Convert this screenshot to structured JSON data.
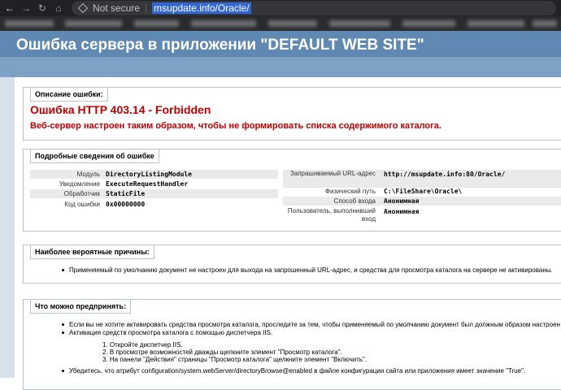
{
  "browser": {
    "security_label": "Not secure",
    "url": "msupdate.info/Oracle/"
  },
  "page": {
    "title": "Ошибка сервера в приложении \"DEFAULT WEB SITE\""
  },
  "error_section": {
    "header": "Описание ошибки:",
    "code": "Ошибка HTTP 403.14 - Forbidden",
    "message": "Веб-сервер настроен таким образом, чтобы не формировать списка содержимого каталога."
  },
  "details_section": {
    "header": "Подробные сведения об ошибке",
    "left": [
      {
        "label": "Модуль",
        "value": "DirectoryListingModule"
      },
      {
        "label": "Уведомление",
        "value": "ExecuteRequestHandler"
      },
      {
        "label": "Обработчик",
        "value": "StaticFile"
      },
      {
        "label": "Код ошибки",
        "value": "0x00000000"
      }
    ],
    "right": [
      {
        "label": "Запрашиваемый URL-адрес",
        "value": "http://msupdate.info:80/Oracle/"
      },
      {
        "label": "Физический путь",
        "value": "C:\\FileShare\\Oracle\\"
      },
      {
        "label": "Способ входа",
        "value": "Анонимная"
      },
      {
        "label": "Пользователь, выполнивший вход",
        "value": "Анонимная"
      }
    ]
  },
  "causes_section": {
    "header": "Наиболее вероятные причины:",
    "items": [
      "Применяемый по умолчанию документ не настроен для выхода на запрошенный URL-адрес, и средства для просмотра каталога на сервере не активированы."
    ]
  },
  "actions_section": {
    "header": "Что можно предпринять:",
    "items": [
      "Если вы не хотите активировать средства просмотра каталога, проследите за тем, чтобы применяемый по умолчанию документ был должным образом настроен и",
      "Активация средств просмотра каталога с помощью диспетчера IIS.",
      "Убедитесь, что атрибут configuration/system.webServer/directoryBrowse@enabled в файле конфигурации сайта или приложения имеет значение \"True\"."
    ],
    "steps": [
      "1. Откройте диспетчер IIS.",
      "2. В просмотре возможностей дважды щелкните элемент \"Просмотр каталога\".",
      "3. На панели \"Действия\" страницы \"Просмотр каталога\" щелкните элемент \"Включить\"."
    ]
  }
}
